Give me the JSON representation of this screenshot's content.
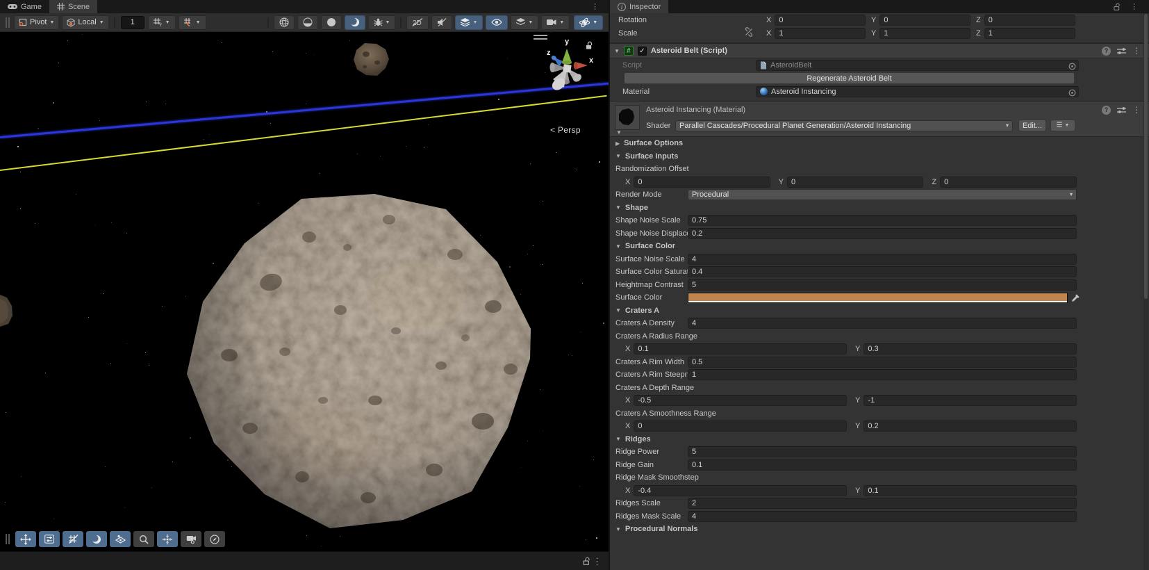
{
  "scene": {
    "tabs": {
      "game": "Game",
      "scene": "Scene"
    },
    "toolbar": {
      "pivot": "Pivot",
      "orientation": "Local",
      "snap_increment": "1",
      "grid_axis": "Y",
      "mode_2d": "2D"
    },
    "viewport": {
      "persp": "< Persp",
      "axis_x": "x",
      "axis_y": "y",
      "axis_z": "z"
    },
    "colors": {
      "active_toggle_blue": "#46607e",
      "overlay_toggle_blue": "#4f6d8e",
      "orbit_line_blue": "#2b36d8",
      "ring_line_yellow": "#d6d833"
    }
  },
  "inspector": {
    "tab": "Inspector",
    "transform": {
      "rows": [
        {
          "label": "Rotation",
          "x": "0",
          "y": "0",
          "z": "0"
        },
        {
          "label": "Scale",
          "x": "1",
          "y": "1",
          "z": "1"
        }
      ]
    },
    "component": {
      "title": "Asteroid Belt (Script)",
      "script_label": "Script",
      "script_value": "AsteroidBelt",
      "regenerate_button": "Regenerate Asteroid Belt",
      "material_label": "Material",
      "material_value": "Asteroid Instancing"
    },
    "material": {
      "title": "Asteroid Instancing (Material)",
      "shader_label": "Shader",
      "shader_value": "Parallel Cascades/Procedural Planet Generation/Asteroid Instancing",
      "edit_button": "Edit...",
      "surface_color_hex": "#c0854f",
      "rows": [
        {
          "kind": "foldout",
          "open": false,
          "label": "Surface Options"
        },
        {
          "kind": "foldout",
          "open": true,
          "label": "Surface Inputs"
        },
        {
          "kind": "label",
          "label": "Randomization Offset"
        },
        {
          "kind": "vec3",
          "x": "0",
          "y": "0",
          "z": "0"
        },
        {
          "kind": "dropdown",
          "label": "Render Mode",
          "value": "Procedural"
        },
        {
          "kind": "foldout",
          "open": true,
          "label": "Shape"
        },
        {
          "kind": "field",
          "label": "Shape Noise Scale",
          "value": "0.75"
        },
        {
          "kind": "field",
          "label": "Shape Noise Displacement",
          "value": "0.2"
        },
        {
          "kind": "foldout",
          "open": true,
          "label": "Surface Color"
        },
        {
          "kind": "field",
          "label": "Surface Noise Scale",
          "value": "4"
        },
        {
          "kind": "field",
          "label": "Surface Color Saturation",
          "value": "0.4"
        },
        {
          "kind": "field",
          "label": "Heightmap Contrast",
          "value": "5"
        },
        {
          "kind": "color",
          "label": "Surface Color",
          "value": "#c0854f"
        },
        {
          "kind": "foldout",
          "open": true,
          "label": "Craters A"
        },
        {
          "kind": "field",
          "label": "Craters A Density",
          "value": "4"
        },
        {
          "kind": "label",
          "label": "Craters A Radius Range"
        },
        {
          "kind": "vec2",
          "x": "0.1",
          "y": "0.3"
        },
        {
          "kind": "field",
          "label": "Craters A Rim Width",
          "value": "0.5"
        },
        {
          "kind": "field",
          "label": "Craters A Rim Steepness",
          "value": "1"
        },
        {
          "kind": "label",
          "label": "Craters A Depth Range"
        },
        {
          "kind": "vec2",
          "x": "-0.5",
          "y": "-1"
        },
        {
          "kind": "label",
          "label": "Craters A Smoothness Range"
        },
        {
          "kind": "vec2",
          "x": "0",
          "y": "0.2"
        },
        {
          "kind": "foldout",
          "open": true,
          "label": "Ridges"
        },
        {
          "kind": "field",
          "label": "Ridge Power",
          "value": "5"
        },
        {
          "kind": "field",
          "label": "Ridge Gain",
          "value": "0.1"
        },
        {
          "kind": "label",
          "label": "Ridge Mask Smoothstep"
        },
        {
          "kind": "vec2",
          "x": "-0.4",
          "y": "0.1"
        },
        {
          "kind": "field",
          "label": "Ridges Scale",
          "value": "2"
        },
        {
          "kind": "field",
          "label": "Ridges Mask Scale",
          "value": "4"
        },
        {
          "kind": "foldout",
          "open": true,
          "label": "Procedural Normals"
        }
      ]
    }
  }
}
